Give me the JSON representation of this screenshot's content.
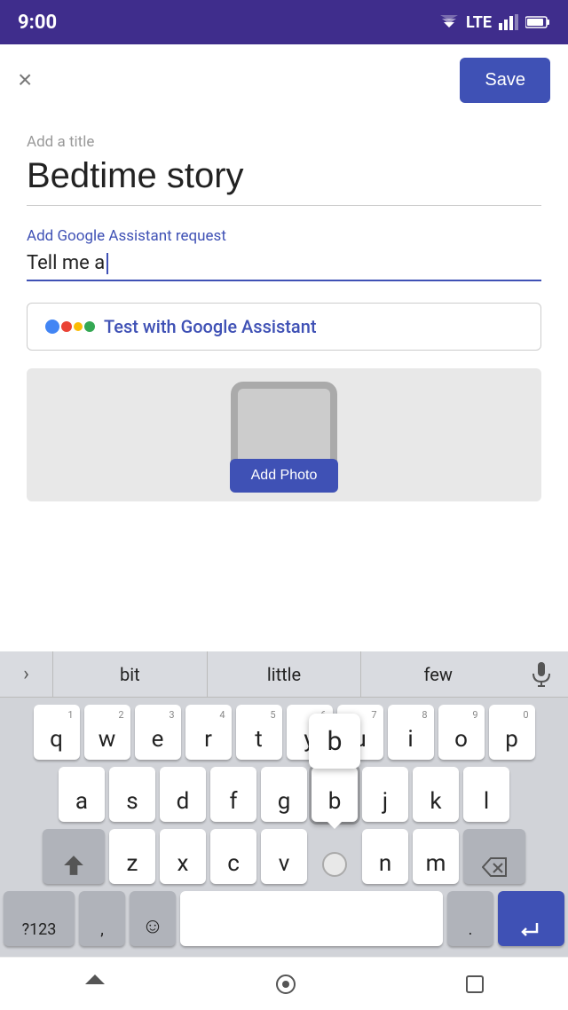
{
  "statusBar": {
    "time": "9:00",
    "lteLabel": "LTE"
  },
  "topBar": {
    "closeLabel": "×",
    "saveLabel": "Save"
  },
  "form": {
    "titlePlaceholder": "Add a title",
    "titleValue": "Bedtime story",
    "requestLabel": "Add Google Assistant request",
    "requestValue": "Tell me a",
    "testButtonText": "Test with Google Assistant"
  },
  "addPhoto": {
    "label": "Add Photo"
  },
  "suggestions": {
    "expandLabel": ">",
    "items": [
      "bit",
      "little",
      "few"
    ]
  },
  "keyboard": {
    "row1": [
      {
        "char": "q",
        "num": "1"
      },
      {
        "char": "w",
        "num": "2"
      },
      {
        "char": "e",
        "num": "3"
      },
      {
        "char": "r",
        "num": "4"
      },
      {
        "char": "t",
        "num": "5"
      },
      {
        "char": "y",
        "num": "6"
      },
      {
        "char": "u",
        "num": "7"
      },
      {
        "char": "i",
        "num": "8"
      },
      {
        "char": "o",
        "num": "9"
      },
      {
        "char": "p",
        "num": "0"
      }
    ],
    "row2": [
      {
        "char": "a"
      },
      {
        "char": "s"
      },
      {
        "char": "d"
      },
      {
        "char": "f"
      },
      {
        "char": "g"
      },
      {
        "char": "b",
        "highlighted": true
      },
      {
        "char": "j"
      },
      {
        "char": "k"
      },
      {
        "char": "l"
      }
    ],
    "row3": [
      {
        "char": "z"
      },
      {
        "char": "x"
      },
      {
        "char": "c"
      },
      {
        "char": "v"
      },
      {
        "char": "n"
      },
      {
        "char": "m"
      }
    ],
    "bottomRow": {
      "numLabel": "?123",
      "commaLabel": ",",
      "dotLabel": ".",
      "enterIcon": "↵"
    }
  }
}
